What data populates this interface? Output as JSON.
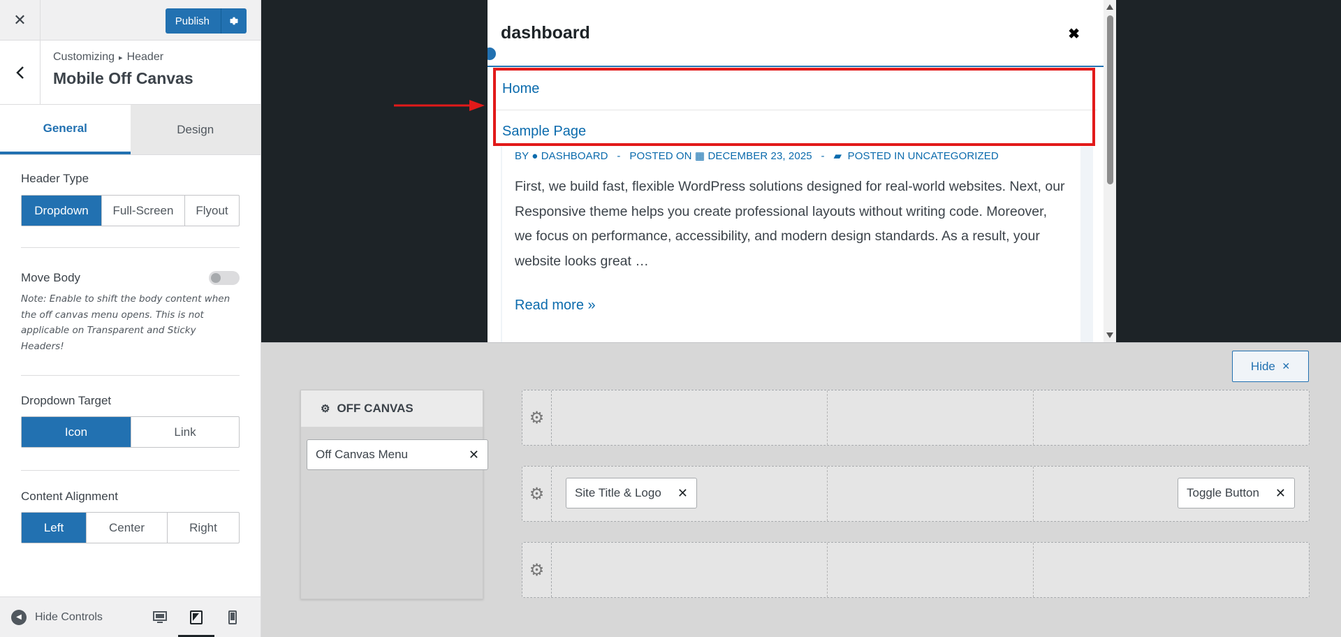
{
  "topbar": {
    "close_icon": "close-icon",
    "publish_label": "Publish",
    "settings_icon": "gear-icon"
  },
  "breadcrumb": {
    "root": "Customizing",
    "separator": "▸",
    "section": "Header",
    "title": "Mobile Off Canvas"
  },
  "tabs": [
    {
      "label": "General",
      "active": true
    },
    {
      "label": "Design",
      "active": false
    }
  ],
  "controls": {
    "header_type": {
      "label": "Header Type",
      "options": [
        "Dropdown",
        "Full-Screen",
        "Flyout"
      ],
      "selected": "Dropdown"
    },
    "move_body": {
      "label": "Move Body",
      "enabled": false,
      "note": "Note: Enable to shift the body content when the off canvas menu opens. This is not applicable on Transparent and Sticky Headers!"
    },
    "dropdown_target": {
      "label": "Dropdown Target",
      "options": [
        "Icon",
        "Link"
      ],
      "selected": "Icon"
    },
    "content_alignment": {
      "label": "Content Alignment",
      "options": [
        "Left",
        "Center",
        "Right"
      ],
      "selected": "Left"
    }
  },
  "footer": {
    "hide_controls_label": "Hide Controls",
    "devices": [
      "desktop",
      "tablet",
      "mobile"
    ],
    "active_device": "tablet"
  },
  "preview": {
    "site_title": "dashboard",
    "close_glyph": "✖",
    "menu_items": [
      "Home",
      "Sample Page"
    ],
    "post_meta": {
      "by": "BY",
      "author": "DASHBOARD",
      "posted_on": "POSTED ON",
      "date": "DECEMBER 23, 2025",
      "posted_in": "POSTED IN UNCATEGORIZED",
      "dash": "-"
    },
    "excerpt": "First, we build fast, flexible WordPress solutions designed for real-world websites. Next, our Responsive theme helps you create professional layouts without writing code. Moreover, we focus on performance, accessibility, and modern design standards. As a result, your website looks great …",
    "read_more": "Read more »",
    "highlight_color": "#e21a1a"
  },
  "builder": {
    "hide_label": "Hide",
    "hide_glyph": "✕",
    "off_canvas_title": "OFF CANVAS",
    "off_canvas_items": [
      "Off Canvas Menu"
    ],
    "rows": [
      {
        "items_left": [],
        "items_right": []
      },
      {
        "items_left": [
          "Site Title & Logo"
        ],
        "items_right": [
          "Toggle Button"
        ]
      },
      {
        "items_left": [],
        "items_right": []
      }
    ],
    "remove_glyph": "✕"
  },
  "colors": {
    "accent": "#2271b1",
    "link": "#0b6bad",
    "sidebar_bg": "#f0f0f1",
    "preview_bg": "#1d2327"
  }
}
